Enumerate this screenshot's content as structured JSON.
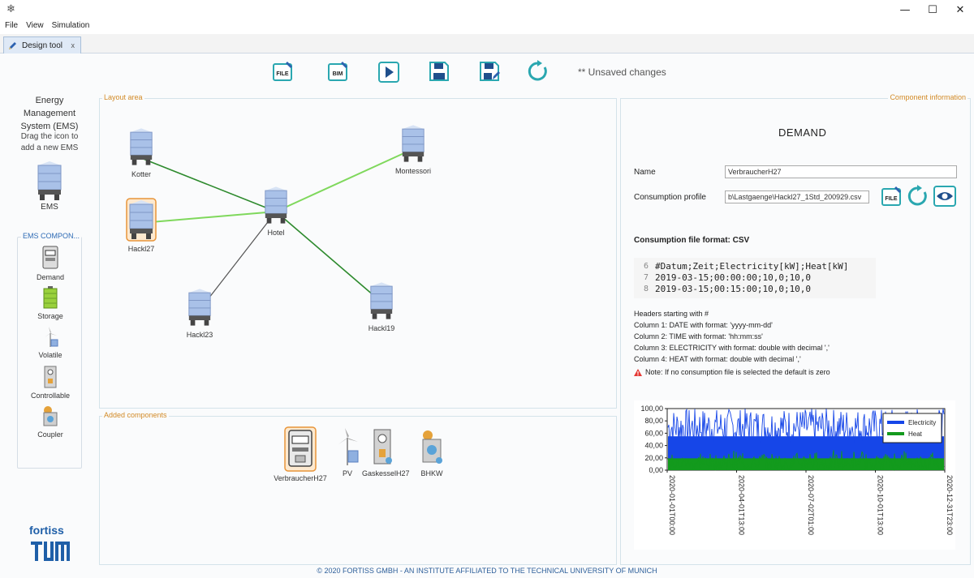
{
  "window": {
    "minimize": "—",
    "maximize": "☐",
    "close": "✕"
  },
  "menu": [
    "File",
    "View",
    "Simulation"
  ],
  "tab": {
    "label": "Design tool",
    "close": "x"
  },
  "toolbar": {
    "file_label": "FILE",
    "bim_label": "BIM",
    "unsaved": "** Unsaved changes"
  },
  "left": {
    "title_line1": "Energy Management",
    "title_line2": "System (EMS)",
    "hint_line1": "Drag the icon to",
    "hint_line2": "add a new EMS",
    "ems_label": "EMS",
    "group_title": "EMS COMPON...",
    "components": [
      "Demand",
      "Storage",
      "Volatile",
      "Controllable",
      "Coupler"
    ],
    "logo_text": "fortiss"
  },
  "layout": {
    "legend": "Layout area",
    "nodes": [
      "Kotter",
      "Montessori",
      "Hotel",
      "Hackl27",
      "Hackl23",
      "Hackl19"
    ]
  },
  "added": {
    "legend": "Added components",
    "items": [
      "VerbraucherH27",
      "PV",
      "GaskesselH27",
      "BHKW"
    ]
  },
  "info": {
    "legend": "Component information",
    "title": "DEMAND",
    "name_label": "Name",
    "name_value": "VerbraucherH27",
    "profile_label": "Consumption profile",
    "profile_value": "b\\Lastgaenge\\Hackl27_1Std_200929.csv",
    "file_btn": "FILE",
    "format_title": "Consumption file format: CSV",
    "code": [
      {
        "ln": "6",
        "text": "#Datum;Zeit;Electricity[kW];Heat[kW]"
      },
      {
        "ln": "7",
        "text": "2019-03-15;00:00:00;10,0;10,0"
      },
      {
        "ln": "8",
        "text": "2019-03-15;00:15:00;10,0;10,0"
      }
    ],
    "lines": [
      "Headers starting with #",
      "Column 1: DATE with format: 'yyyy-mm-dd'",
      "Column 2: TIME with format: 'hh:mm:ss'",
      "Column 3: ELECTRICITY with format: double with decimal ','",
      "Column 4: HEAT with format: double with decimal ','"
    ],
    "note": "Note: If no consumption file is selected the default is zero"
  },
  "chart_data": {
    "type": "line",
    "ylim": [
      0,
      100
    ],
    "yticks": [
      "0,00",
      "20,00",
      "40,00",
      "60,00",
      "80,00",
      "100,00"
    ],
    "xticks": [
      "2020-01-01T00:00",
      "2020-04-01T13:00",
      "2020-07-02T01:00",
      "2020-10-01T13:00",
      "2020-12-31T23:00"
    ],
    "series": [
      {
        "name": "Electricity",
        "color": "#1646e8",
        "range": [
          40,
          100
        ]
      },
      {
        "name": "Heat",
        "color": "#139a1d",
        "range": [
          0,
          35
        ]
      }
    ],
    "legend": "top-right"
  },
  "footer": "© 2020 FORTISS GMBH - AN INSTITUTE AFFILIATED TO THE TECHNICAL UNIVERSITY OF MUNICH",
  "colors": {
    "accent_teal": "#2aa7b0",
    "legend_orange": "#d28a26",
    "link_blue": "#2d5f9a"
  }
}
